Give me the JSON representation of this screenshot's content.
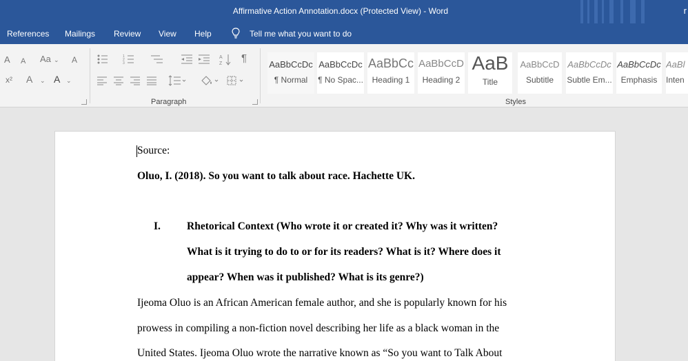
{
  "window": {
    "title": "Affirmative Action Annotation.docx (Protected View)  -  Word",
    "user_initial": "r"
  },
  "menu": {
    "tabs": [
      "References",
      "Mailings",
      "Review",
      "View",
      "Help"
    ],
    "tell_me": "Tell me what you want to do"
  },
  "ribbon": {
    "paragraph_label": "Paragraph",
    "styles_label": "Styles",
    "font_icons": {
      "grow_font": "A",
      "shrink_font": "A",
      "change_case": "Aa",
      "clear_formatting": "A",
      "superscript": "x²",
      "text_effects": "A",
      "font_color": "A"
    },
    "pilcrow": "¶",
    "styles": [
      {
        "sample": "AaBbCcDc",
        "name": "¶ Normal"
      },
      {
        "sample": "AaBbCcDc",
        "name": "¶ No Spac..."
      },
      {
        "sample": "AaBbCc",
        "name": "Heading 1"
      },
      {
        "sample": "AaBbCcD",
        "name": "Heading 2"
      },
      {
        "sample": "AaB",
        "name": "Title"
      },
      {
        "sample": "AaBbCcD",
        "name": "Subtitle"
      },
      {
        "sample": "AaBbCcDc",
        "name": "Subtle Em..."
      },
      {
        "sample": "AaBbCcDc",
        "name": "Emphasis"
      },
      {
        "sample": "AaBl",
        "name": "Inten"
      }
    ]
  },
  "document": {
    "lines": [
      {
        "text": "Source:",
        "bold": false
      },
      {
        "text": "Oluo, I. (2018). So you want to talk about race. Hachette UK.",
        "bold": true
      },
      {
        "numeral": "I.",
        "text": "Rhetorical Context (Who wrote it or created it? Why was it written?",
        "bold": true
      },
      {
        "text": "What is it trying to do to or for its readers? What is it? Where does it",
        "bold": true
      },
      {
        "text": "appear? When was it published? What is its genre?)",
        "bold": true
      },
      {
        "text": "Ijeoma Oluo is an African American female author, and she is popularly known for his",
        "bold": false
      },
      {
        "text": "prowess in compiling a non-fiction novel describing her life as a black woman in the",
        "bold": false
      },
      {
        "text": "United States. Ijeoma Oluo wrote the narrative known as “So you want to Talk About",
        "bold": false
      }
    ]
  },
  "colors": {
    "titlebar": "#2b579a",
    "ribbon": "#f3f3f3",
    "canvas": "#e6e6e6"
  }
}
